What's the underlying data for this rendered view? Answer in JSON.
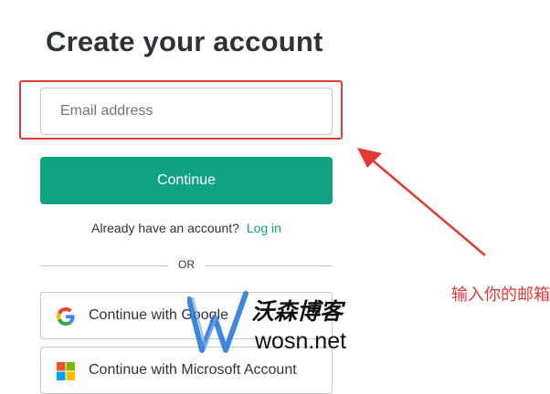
{
  "page": {
    "title": "Create your account"
  },
  "email": {
    "placeholder": "Email address",
    "value": ""
  },
  "continue_button": {
    "label": "Continue"
  },
  "login_prompt": {
    "text": "Already have an account?",
    "link_label": "Log in"
  },
  "divider": {
    "label": "OR"
  },
  "social_buttons": [
    {
      "label": "Continue with Google",
      "icon": "google-icon"
    },
    {
      "label": "Continue with Microsoft Account",
      "icon": "microsoft-icon"
    }
  ],
  "annotation": {
    "text": "输入你的邮箱",
    "color": "#e53935"
  },
  "watermark": {
    "brand_cn": "沃森博客",
    "brand_en": "wosn.net"
  },
  "colors": {
    "accent": "#10a37f",
    "annotation": "#e53935",
    "title": "#2d333a"
  }
}
